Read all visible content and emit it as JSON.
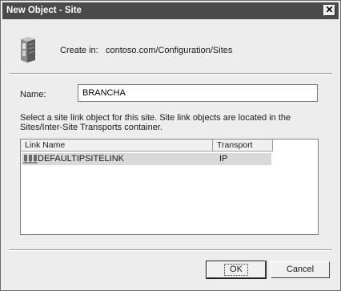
{
  "window": {
    "title": "New Object - Site",
    "close_glyph": "✕"
  },
  "header": {
    "icon": "site-icon",
    "create_in_label": "Create in:",
    "create_in_path": "contoso.com/Configuration/Sites"
  },
  "form": {
    "name_label": "Name:",
    "name_value": "BRANCHA",
    "description": "Select a site link object for this site. Site link objects are located in the Sites/Inter-Site Transports container."
  },
  "site_links": {
    "columns": [
      "Link Name",
      "Transport"
    ],
    "rows": [
      {
        "icon": "site-link-icon",
        "link_name": "DEFAULTIPSITELINK",
        "transport": "IP",
        "selected": true
      }
    ]
  },
  "buttons": {
    "ok_label": "OK",
    "cancel_label": "Cancel"
  }
}
